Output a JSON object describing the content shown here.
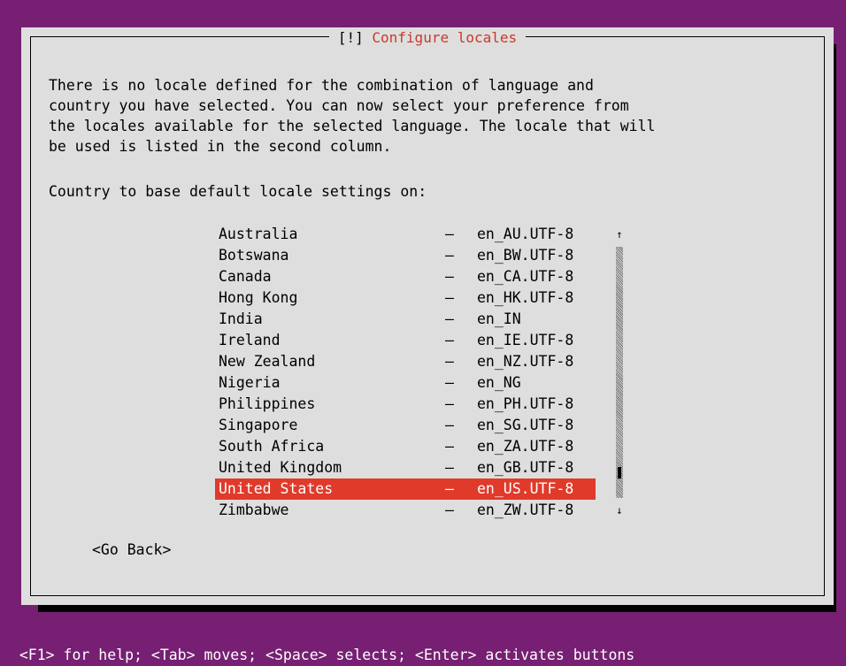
{
  "dialog": {
    "title_marker": "[!]",
    "title": "Configure locales",
    "description": "There is no locale defined for the combination of language and\ncountry you have selected. You can now select your preference from\nthe locales available for the selected language. The locale that will\nbe used is listed in the second column.",
    "prompt": "Country to base default locale settings on:",
    "separator": "–",
    "locales": [
      {
        "country": "Australia",
        "code": "en_AU.UTF-8"
      },
      {
        "country": "Botswana",
        "code": "en_BW.UTF-8"
      },
      {
        "country": "Canada",
        "code": "en_CA.UTF-8"
      },
      {
        "country": "Hong Kong",
        "code": "en_HK.UTF-8"
      },
      {
        "country": "India",
        "code": "en_IN"
      },
      {
        "country": "Ireland",
        "code": "en_IE.UTF-8"
      },
      {
        "country": "New Zealand",
        "code": "en_NZ.UTF-8"
      },
      {
        "country": "Nigeria",
        "code": "en_NG"
      },
      {
        "country": "Philippines",
        "code": "en_PH.UTF-8"
      },
      {
        "country": "Singapore",
        "code": "en_SG.UTF-8"
      },
      {
        "country": "South Africa",
        "code": "en_ZA.UTF-8"
      },
      {
        "country": "United Kingdom",
        "code": "en_GB.UTF-8"
      },
      {
        "country": "United States",
        "code": "en_US.UTF-8"
      },
      {
        "country": "Zimbabwe",
        "code": "en_ZW.UTF-8"
      }
    ],
    "selected_index": 12,
    "scroll": {
      "up_arrow": "↑",
      "down_arrow": "↓",
      "thumb_position": 0.92
    },
    "go_back_label": "<Go Back>"
  },
  "statusbar": {
    "text": "<F1> for help; <Tab> moves; <Space> selects; <Enter> activates buttons"
  },
  "colors": {
    "background": "#761f73",
    "dialog": "#dedede",
    "selection": "#e03a2a",
    "title_text": "#c73a2b"
  }
}
